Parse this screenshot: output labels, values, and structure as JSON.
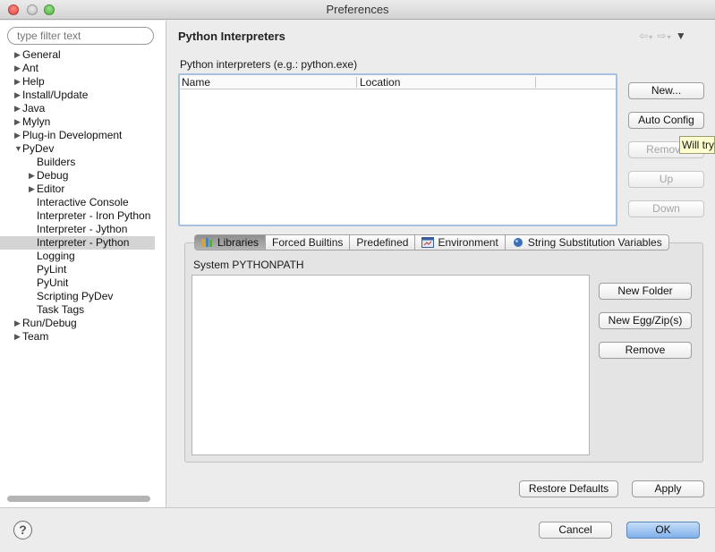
{
  "window": {
    "title": "Preferences"
  },
  "sidebar": {
    "filter_placeholder": "type filter text",
    "items": [
      {
        "label": "General",
        "arrow": "▶"
      },
      {
        "label": "Ant",
        "arrow": "▶"
      },
      {
        "label": "Help",
        "arrow": "▶"
      },
      {
        "label": "Install/Update",
        "arrow": "▶"
      },
      {
        "label": "Java",
        "arrow": "▶"
      },
      {
        "label": "Mylyn",
        "arrow": "▶"
      },
      {
        "label": "Plug-in Development",
        "arrow": "▶"
      },
      {
        "label": "PyDev",
        "arrow": "▼"
      },
      {
        "label": "Builders",
        "arrow": ""
      },
      {
        "label": "Debug",
        "arrow": "▶"
      },
      {
        "label": "Editor",
        "arrow": "▶"
      },
      {
        "label": "Interactive Console",
        "arrow": ""
      },
      {
        "label": "Interpreter - Iron Python",
        "arrow": ""
      },
      {
        "label": "Interpreter - Jython",
        "arrow": ""
      },
      {
        "label": "Interpreter - Python",
        "arrow": ""
      },
      {
        "label": "Logging",
        "arrow": ""
      },
      {
        "label": "PyLint",
        "arrow": ""
      },
      {
        "label": "PyUnit",
        "arrow": ""
      },
      {
        "label": "Scripting PyDev",
        "arrow": ""
      },
      {
        "label": "Task Tags",
        "arrow": ""
      },
      {
        "label": "Run/Debug",
        "arrow": "▶"
      },
      {
        "label": "Team",
        "arrow": "▶"
      }
    ]
  },
  "main": {
    "title": "Python Interpreters",
    "nav": {
      "back": "⇦",
      "forward": "⇨",
      "menu": "▼"
    },
    "interpreters_label": "Python interpreters (e.g.: python.exe)",
    "columns": {
      "name": "Name",
      "location": "Location"
    },
    "buttons": {
      "new": "New...",
      "auto_config": "Auto Config",
      "remove": "Remove",
      "up": "Up",
      "down": "Down"
    },
    "tooltip": "Will try",
    "tabs": {
      "libraries": "Libraries",
      "forced_builtins": "Forced Builtins",
      "predefined": "Predefined",
      "environment": "Environment",
      "string_substitution": "String Substitution Variables"
    },
    "system_pythonpath_label": "System PYTHONPATH",
    "path_buttons": {
      "new_folder": "New Folder",
      "new_egg": "New Egg/Zip(s)",
      "remove": "Remove"
    },
    "restore_defaults": "Restore Defaults",
    "apply": "Apply"
  },
  "footer": {
    "help": "?",
    "cancel": "Cancel",
    "ok": "OK"
  }
}
